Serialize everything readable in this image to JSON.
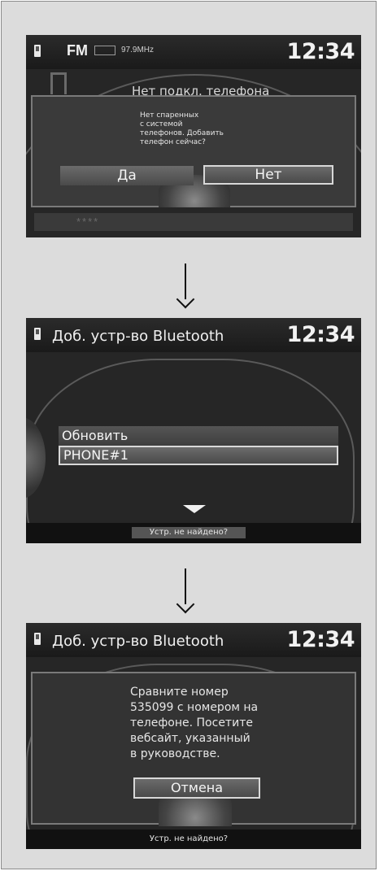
{
  "screen1": {
    "band": "FM",
    "freq": "97.9MHz",
    "clock": "12:34",
    "bg_text": "Нет подкл. телефона",
    "message": "Нет спаренных\nс системой\nтелефонов. Добавить\nтелефон сейчас?",
    "yes_label": "Да",
    "no_label": "Нет",
    "stars": "****"
  },
  "screen2": {
    "title": "Доб. устр-во Bluetooth",
    "clock": "12:34",
    "items": [
      {
        "label": "Обновить"
      },
      {
        "label": "PHONE#1"
      }
    ],
    "footer": "Устр. не найдено?"
  },
  "screen3": {
    "title": "Доб. устр-во Bluetooth",
    "clock": "12:34",
    "message": "Сравните номер\n535099 с номером на\nтелефоне. Посетите\nвебсайт, указанный\nв руководстве.",
    "cancel_label": "Отмена",
    "footer": "Устр. не найдено?"
  }
}
